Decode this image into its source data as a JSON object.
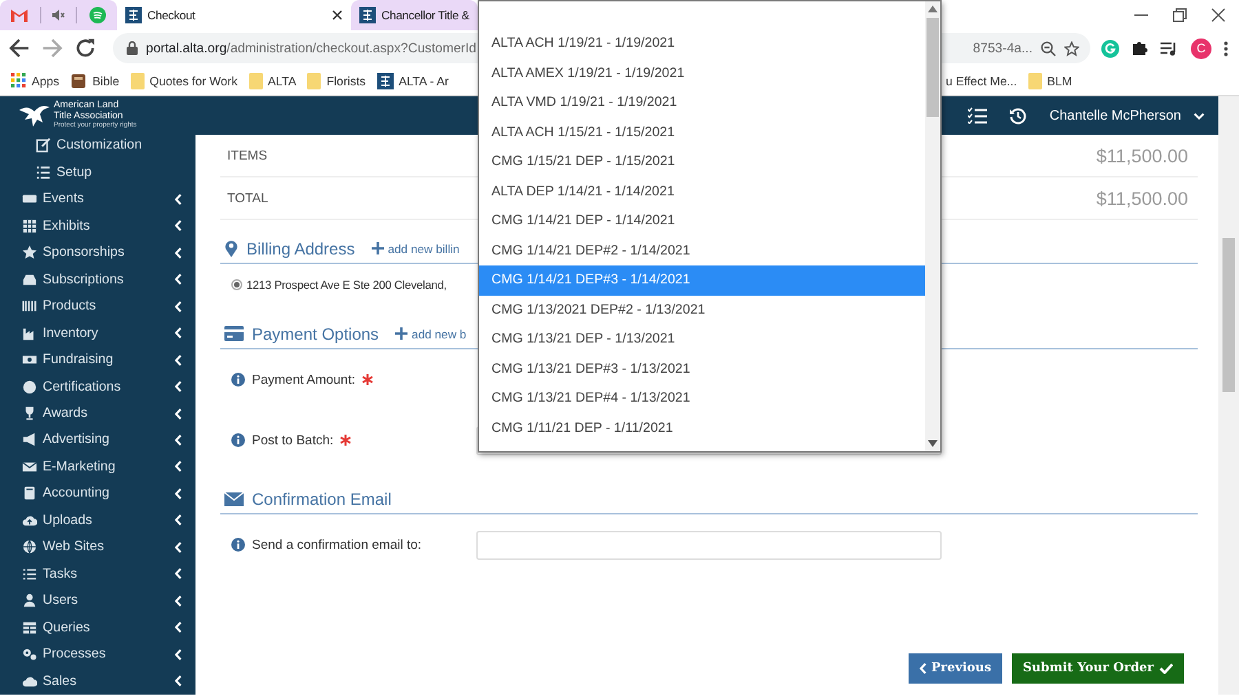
{
  "browser": {
    "tabs": [
      {
        "title": "Checkout",
        "selected": true
      },
      {
        "title": "Chancellor Title &",
        "selected": false
      }
    ],
    "address": {
      "host": "portal.alta.org",
      "path": "/administration/checkout.aspx?CustomerId",
      "tail": "8753-4a..."
    },
    "bookmarks_left": [
      {
        "label": "Apps",
        "kind": "apps"
      },
      {
        "label": "Bible",
        "kind": "book"
      },
      {
        "label": "Quotes for Work",
        "kind": "folder"
      },
      {
        "label": "ALTA",
        "kind": "folder"
      },
      {
        "label": "Florists",
        "kind": "folder"
      },
      {
        "label": "ALTA - Ar",
        "kind": "site"
      }
    ],
    "bookmarks_right": [
      {
        "label": "u Effect Me...",
        "kind": "none"
      },
      {
        "label": "BLM",
        "kind": "folder"
      }
    ],
    "profile": {
      "initial": "C"
    }
  },
  "logo": {
    "lines": [
      "American Land",
      "Title Association"
    ],
    "tagline": "Protect your property rights"
  },
  "user": {
    "name": "Chantelle McPherson"
  },
  "sidebar": {
    "items": [
      {
        "label": "Customization",
        "expandable": false
      },
      {
        "label": "Setup",
        "expandable": false
      },
      {
        "label": "Events",
        "expandable": true
      },
      {
        "label": "Exhibits",
        "expandable": true
      },
      {
        "label": "Sponsorships",
        "expandable": true
      },
      {
        "label": "Subscriptions",
        "expandable": true
      },
      {
        "label": "Products",
        "expandable": true
      },
      {
        "label": "Inventory",
        "expandable": true
      },
      {
        "label": "Fundraising",
        "expandable": true
      },
      {
        "label": "Certifications",
        "expandable": true
      },
      {
        "label": "Awards",
        "expandable": true
      },
      {
        "label": "Advertising",
        "expandable": true
      },
      {
        "label": "E-Marketing",
        "expandable": true
      },
      {
        "label": "Accounting",
        "expandable": true
      },
      {
        "label": "Uploads",
        "expandable": true
      },
      {
        "label": "Web Sites",
        "expandable": true
      },
      {
        "label": "Tasks",
        "expandable": true
      },
      {
        "label": "Users",
        "expandable": true
      },
      {
        "label": "Queries",
        "expandable": true
      },
      {
        "label": "Processes",
        "expandable": true
      },
      {
        "label": "Sales",
        "expandable": true
      }
    ]
  },
  "order": {
    "rows": [
      {
        "label": "ITEMS",
        "amount": "$11,500.00"
      },
      {
        "label": "TOTAL",
        "amount": "$11,500.00"
      }
    ]
  },
  "sections": [
    {
      "kind": "billing",
      "title": "Billing Address",
      "add_link": "add new billin",
      "addresses": [
        {
          "text": "1213 Prospect Ave E Ste 200 Cleveland,",
          "selected": true
        }
      ]
    },
    {
      "kind": "payment",
      "title": "Payment Options",
      "add_link": "add new b",
      "fields": [
        {
          "label": "Payment Amount:",
          "required": true,
          "kind": "covered"
        },
        {
          "label": "Post to Batch:",
          "required": true,
          "kind": "select"
        }
      ]
    },
    {
      "kind": "email",
      "title": "Confirmation Email",
      "fields": [
        {
          "label": "Send a confirmation email to:",
          "required": false,
          "kind": "text"
        }
      ]
    }
  ],
  "dropdown": {
    "options": [
      {
        "label": "ALTA ACH 1/19/21 - 1/19/2021",
        "selected": false
      },
      {
        "label": "ALTA AMEX 1/19/21 - 1/19/2021",
        "selected": false
      },
      {
        "label": "ALTA VMD 1/19/21 - 1/19/2021",
        "selected": false
      },
      {
        "label": "ALTA ACH 1/15/21 - 1/15/2021",
        "selected": false
      },
      {
        "label": "CMG 1/15/21 DEP - 1/15/2021",
        "selected": false
      },
      {
        "label": "ALTA DEP 1/14/21 - 1/14/2021",
        "selected": false
      },
      {
        "label": "CMG 1/14/21 DEP - 1/14/2021",
        "selected": false
      },
      {
        "label": "CMG 1/14/21 DEP#2 - 1/14/2021",
        "selected": false
      },
      {
        "label": "CMG 1/14/21 DEP#3 - 1/14/2021",
        "selected": true
      },
      {
        "label": "CMG 1/13/2021 DEP#2 - 1/13/2021",
        "selected": false
      },
      {
        "label": "CMG 1/13/21 DEP - 1/13/2021",
        "selected": false
      },
      {
        "label": "CMG 1/13/21 DEP#3 - 1/13/2021",
        "selected": false
      },
      {
        "label": "CMG 1/13/21 DEP#4 - 1/13/2021",
        "selected": false
      },
      {
        "label": "CMG 1/11/21 DEP - 1/11/2021",
        "selected": false
      }
    ]
  },
  "buttons": [
    {
      "label": "Previous",
      "kind": "previous"
    },
    {
      "label": "Submit Your Order",
      "kind": "submit"
    }
  ]
}
